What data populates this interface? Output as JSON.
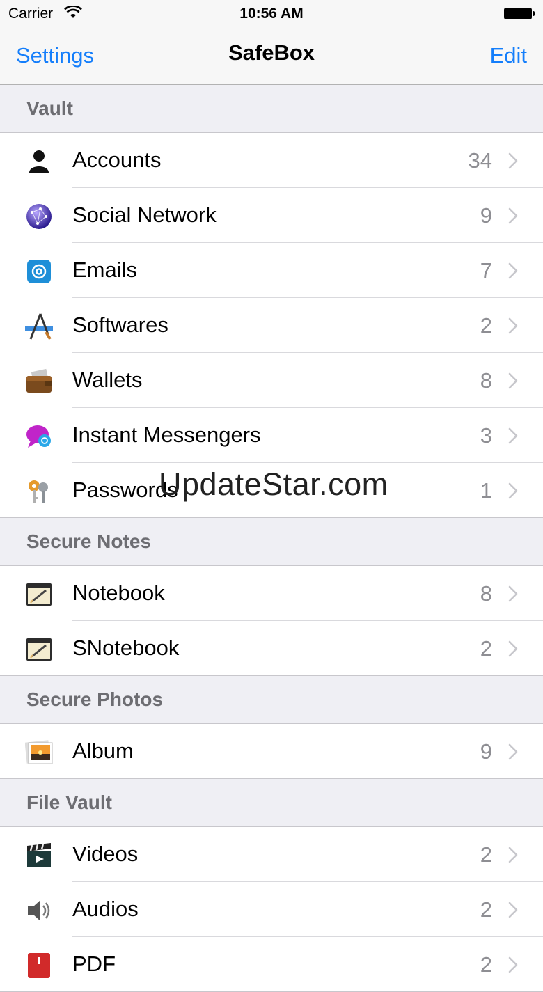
{
  "status": {
    "carrier": "Carrier",
    "time": "10:56 AM"
  },
  "nav": {
    "back": "Settings",
    "title": "SafeBox",
    "edit": "Edit"
  },
  "sections": [
    {
      "title": "Vault",
      "rows": [
        {
          "label": "Accounts",
          "count": "34",
          "icon": "person-icon"
        },
        {
          "label": "Social Network",
          "count": "9",
          "icon": "globe-icon"
        },
        {
          "label": "Emails",
          "count": "7",
          "icon": "email-icon"
        },
        {
          "label": "Softwares",
          "count": "2",
          "icon": "app-store-icon"
        },
        {
          "label": "Wallets",
          "count": "8",
          "icon": "wallet-icon"
        },
        {
          "label": "Instant Messengers",
          "count": "3",
          "icon": "chat-bubble-icon"
        },
        {
          "label": "Passwords",
          "count": "1",
          "icon": "keys-icon"
        }
      ]
    },
    {
      "title": "Secure Notes",
      "rows": [
        {
          "label": "Notebook",
          "count": "8",
          "icon": "notepad-icon"
        },
        {
          "label": "SNotebook",
          "count": "2",
          "icon": "notepad-icon"
        }
      ]
    },
    {
      "title": "Secure Photos",
      "rows": [
        {
          "label": "Album",
          "count": "9",
          "icon": "photo-icon"
        }
      ]
    },
    {
      "title": "File Vault",
      "rows": [
        {
          "label": "Videos",
          "count": "2",
          "icon": "clapperboard-icon"
        },
        {
          "label": "Audios",
          "count": "2",
          "icon": "speaker-icon"
        },
        {
          "label": "PDF",
          "count": "2",
          "icon": "pdf-icon"
        }
      ]
    }
  ],
  "watermark": "UpdateStar.com",
  "colors": {
    "tint": "#147efb",
    "background": "#efeff4"
  }
}
